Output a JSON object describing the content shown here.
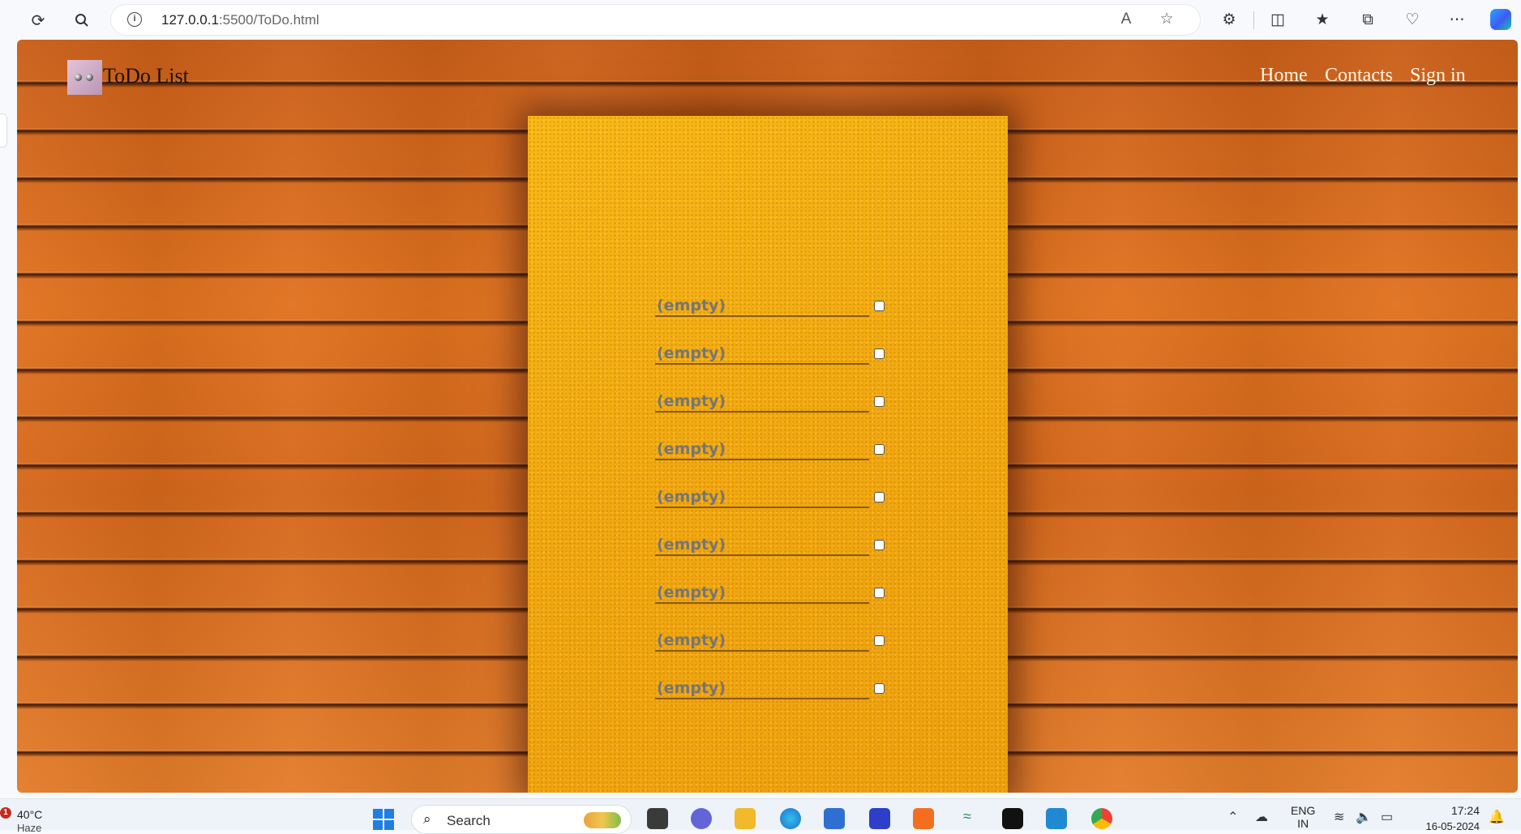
{
  "browser": {
    "url_host": "127.0.0.1",
    "url_rest": ":5500/ToDo.html"
  },
  "site": {
    "brand": "ToDo List",
    "nav": [
      "Home",
      "Contacts",
      "Sign in"
    ]
  },
  "todo": {
    "placeholder": "(empty)",
    "items": [
      {
        "text": "",
        "checked": false
      },
      {
        "text": "",
        "checked": false
      },
      {
        "text": "",
        "checked": false
      },
      {
        "text": "",
        "checked": false
      },
      {
        "text": "",
        "checked": false
      },
      {
        "text": "",
        "checked": false
      },
      {
        "text": "",
        "checked": false
      },
      {
        "text": "",
        "checked": false
      },
      {
        "text": "",
        "checked": false
      }
    ]
  },
  "taskbar": {
    "weather_badge": "1",
    "temperature": "40°C",
    "condition": "Haze",
    "search_label": "Search",
    "language": "ENG",
    "region": "IN",
    "time": "17:24",
    "date": "16-05-2024"
  }
}
